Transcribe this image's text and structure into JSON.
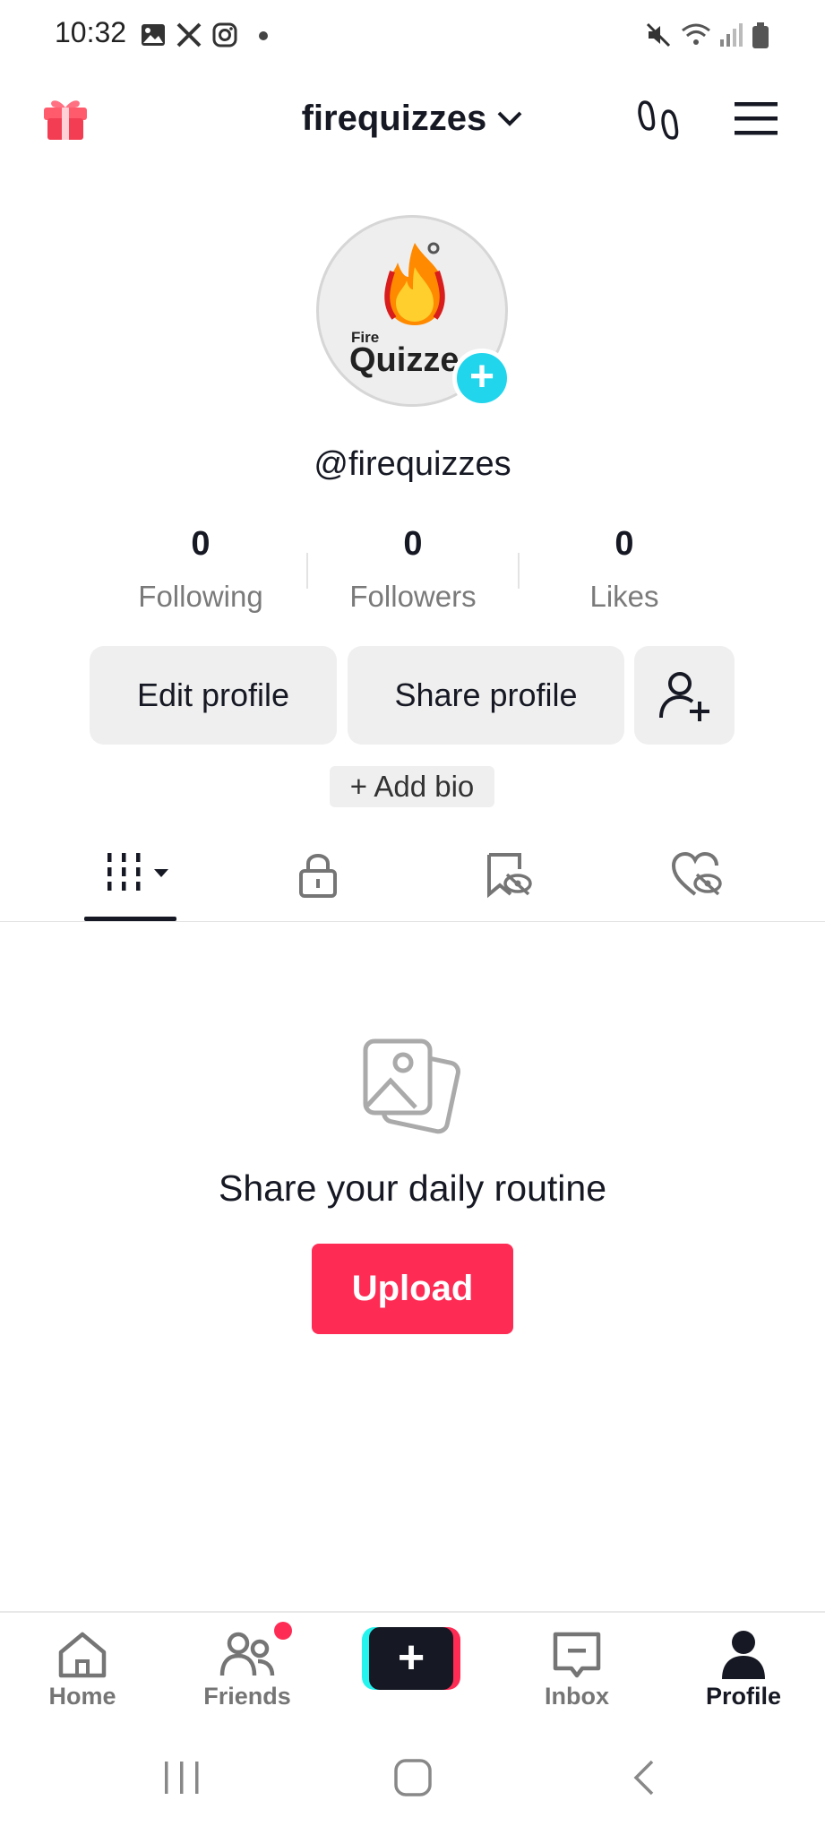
{
  "status_bar": {
    "time": "10:32",
    "left_icons": [
      "gallery-icon",
      "x-icon",
      "instagram-icon",
      "dot-icon"
    ],
    "right_icons": [
      "mute-icon",
      "wifi-icon",
      "signal-icon",
      "battery-icon"
    ]
  },
  "header": {
    "title": "firequizzes",
    "left_icon": "gift-icon",
    "right_icons": [
      "footprints-icon",
      "menu-icon"
    ]
  },
  "profile": {
    "avatar_text_small": "Fire",
    "avatar_text_large": "Quizze",
    "handle": "@firequizzes",
    "stats": [
      {
        "value": "0",
        "label": "Following"
      },
      {
        "value": "0",
        "label": "Followers"
      },
      {
        "value": "0",
        "label": "Likes"
      }
    ],
    "edit_label": "Edit profile",
    "share_label": "Share profile",
    "add_bio_label": "+ Add bio"
  },
  "tabs": [
    "videos-grid-icon",
    "lock-icon",
    "eye-off-tag-icon",
    "heart-hidden-icon"
  ],
  "empty_state": {
    "title": "Share your daily routine",
    "button": "Upload"
  },
  "bottom_nav": [
    {
      "label": "Home",
      "icon": "home-icon"
    },
    {
      "label": "Friends",
      "icon": "friends-icon"
    },
    {
      "label": "",
      "icon": "create-plus-icon"
    },
    {
      "label": "Inbox",
      "icon": "inbox-icon"
    },
    {
      "label": "Profile",
      "icon": "profile-icon"
    }
  ],
  "colors": {
    "accent": "#fe2c55",
    "cyan": "#20d5ec",
    "text": "#161823",
    "muted": "#7a7a7a"
  }
}
